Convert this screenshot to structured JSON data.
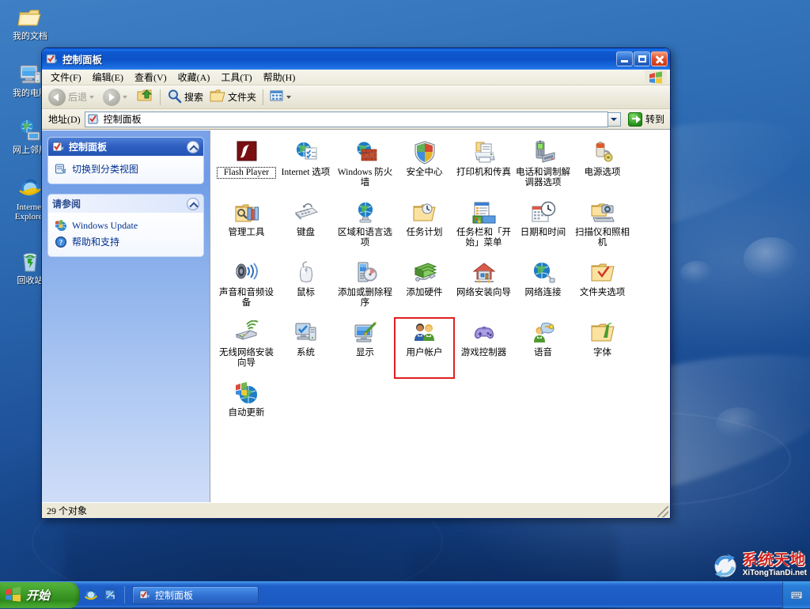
{
  "desktop": {
    "icons": [
      {
        "label": "我的文档",
        "icon": "my-documents-icon"
      },
      {
        "label": "我的电脑",
        "icon": "my-computer-icon"
      },
      {
        "label": "网上邻居",
        "icon": "network-places-icon"
      },
      {
        "label": "Internet Explorer",
        "icon": "internet-explorer-icon"
      },
      {
        "label": "回收站",
        "icon": "recycle-bin-icon"
      }
    ]
  },
  "window": {
    "title": "控制面板",
    "title_icon": "control-panel-icon",
    "controls": {
      "minimize": "最小化",
      "maximize": "最大化",
      "close": "关闭"
    },
    "menu": [
      {
        "label": "文件(F)"
      },
      {
        "label": "编辑(E)"
      },
      {
        "label": "查看(V)"
      },
      {
        "label": "收藏(A)"
      },
      {
        "label": "工具(T)"
      },
      {
        "label": "帮助(H)"
      }
    ],
    "toolbar": {
      "back": "后退",
      "forward": "",
      "up": "",
      "search": "搜索",
      "folders": "文件夹",
      "views": ""
    },
    "address": {
      "label": "地址(D)",
      "value": "控制面板",
      "go": "转到"
    },
    "statusbar": {
      "text": "29 个对象"
    }
  },
  "sidebar": {
    "panels": [
      {
        "title": "控制面板",
        "icon": "control-panel-icon",
        "style": "blue",
        "links": [
          {
            "label": "切换到分类视图",
            "icon": "category-view-icon"
          }
        ]
      },
      {
        "title": "请参阅",
        "icon": "",
        "style": "light",
        "links": [
          {
            "label": "Windows Update",
            "icon": "windows-update-icon"
          },
          {
            "label": "帮助和支持",
            "icon": "help-support-icon"
          }
        ]
      }
    ]
  },
  "control_panel_items": [
    {
      "label": "Flash Player",
      "icon": "flash-player-icon",
      "focused": true,
      "highlighted": false
    },
    {
      "label": "Internet 选项",
      "icon": "internet-options-icon",
      "focused": false,
      "highlighted": false
    },
    {
      "label": "Windows 防火墙",
      "icon": "windows-firewall-icon",
      "focused": false,
      "highlighted": false
    },
    {
      "label": "安全中心",
      "icon": "security-center-icon",
      "focused": false,
      "highlighted": false
    },
    {
      "label": "打印机和传真",
      "icon": "printers-faxes-icon",
      "focused": false,
      "highlighted": false
    },
    {
      "label": "电话和调制解调器选项",
      "icon": "phone-modem-icon",
      "focused": false,
      "highlighted": false
    },
    {
      "label": "电源选项",
      "icon": "power-options-icon",
      "focused": false,
      "highlighted": false
    },
    {
      "label": "管理工具",
      "icon": "admin-tools-icon",
      "focused": false,
      "highlighted": false
    },
    {
      "label": "键盘",
      "icon": "keyboard-icon",
      "focused": false,
      "highlighted": false
    },
    {
      "label": "区域和语言选项",
      "icon": "regional-language-icon",
      "focused": false,
      "highlighted": false
    },
    {
      "label": "任务计划",
      "icon": "scheduled-tasks-icon",
      "focused": false,
      "highlighted": false
    },
    {
      "label": "任务栏和「开始」菜单",
      "icon": "taskbar-start-menu-icon",
      "focused": false,
      "highlighted": false
    },
    {
      "label": "日期和时间",
      "icon": "date-time-icon",
      "focused": false,
      "highlighted": false
    },
    {
      "label": "扫描仪和照相机",
      "icon": "scanners-cameras-icon",
      "focused": false,
      "highlighted": false
    },
    {
      "label": "声音和音频设备",
      "icon": "sounds-audio-icon",
      "focused": false,
      "highlighted": false
    },
    {
      "label": "鼠标",
      "icon": "mouse-icon",
      "focused": false,
      "highlighted": false
    },
    {
      "label": "添加或删除程序",
      "icon": "add-remove-programs-icon",
      "focused": false,
      "highlighted": false
    },
    {
      "label": "添加硬件",
      "icon": "add-hardware-icon",
      "focused": false,
      "highlighted": false
    },
    {
      "label": "网络安装向导",
      "icon": "network-setup-wizard-icon",
      "focused": false,
      "highlighted": false
    },
    {
      "label": "网络连接",
      "icon": "network-connections-icon",
      "focused": false,
      "highlighted": false
    },
    {
      "label": "文件夹选项",
      "icon": "folder-options-icon",
      "focused": false,
      "highlighted": false
    },
    {
      "label": "无线网络安装向导",
      "icon": "wireless-network-wizard-icon",
      "focused": false,
      "highlighted": false
    },
    {
      "label": "系统",
      "icon": "system-icon",
      "focused": false,
      "highlighted": false
    },
    {
      "label": "显示",
      "icon": "display-icon",
      "focused": false,
      "highlighted": false
    },
    {
      "label": "用户帐户",
      "icon": "user-accounts-icon",
      "focused": false,
      "highlighted": true
    },
    {
      "label": "游戏控制器",
      "icon": "game-controllers-icon",
      "focused": false,
      "highlighted": false
    },
    {
      "label": "语音",
      "icon": "speech-icon",
      "focused": false,
      "highlighted": false
    },
    {
      "label": "字体",
      "icon": "fonts-icon",
      "focused": false,
      "highlighted": false
    },
    {
      "label": "自动更新",
      "icon": "automatic-updates-icon",
      "focused": false,
      "highlighted": false
    }
  ],
  "taskbar": {
    "start_label": "开始",
    "quicklaunch": [
      {
        "icon": "internet-explorer-icon"
      },
      {
        "icon": "show-desktop-icon"
      }
    ],
    "tasks": [
      {
        "label": "控制面板",
        "icon": "control-panel-icon"
      }
    ],
    "tray": [
      {
        "icon": "keyboard-tray-icon"
      }
    ]
  },
  "watermark": {
    "cn": "系统天地",
    "en": "XiTongTianDi.net"
  },
  "colors": {
    "titlebar_blue": "#0d52c8",
    "highlight_red": "#e02020",
    "start_green": "#3d9a27",
    "link_blue": "#00308f"
  }
}
